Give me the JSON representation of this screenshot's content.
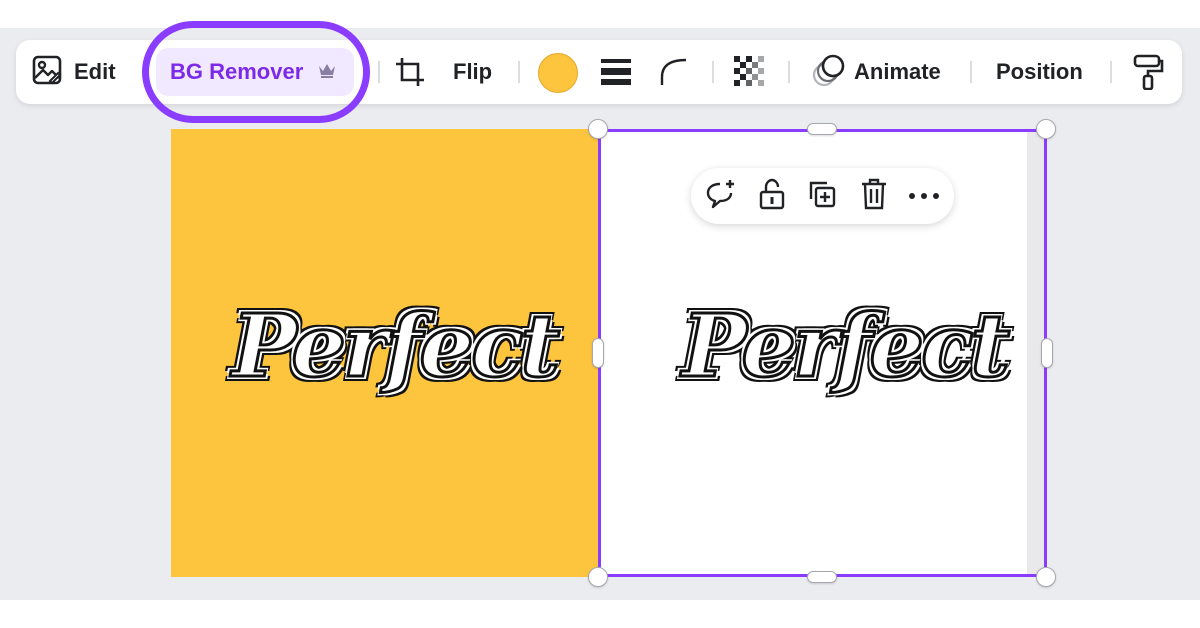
{
  "toolbar": {
    "edit_label": "Edit",
    "bg_remover_label": "BG Remover",
    "flip_label": "Flip",
    "animate_label": "Animate",
    "position_label": "Position",
    "color_swatch": "#fdc43e",
    "highlight_color": "#8b3dff",
    "icons": [
      "edit-image-icon",
      "crown-icon",
      "crop-icon",
      "line-weight-icon",
      "corner-rounding-icon",
      "transparency-icon",
      "animate-icon",
      "paint-roller-icon"
    ]
  },
  "canvas": {
    "left_panel": {
      "color": "#fdc43e",
      "text": "Perfect"
    },
    "right_panel": {
      "color": "#ffffff",
      "text": "Perfect",
      "selected": true
    },
    "selection_color": "#8b3dff"
  },
  "context_menu": {
    "icons": [
      "add-comment-icon",
      "lock-icon",
      "duplicate-icon",
      "delete-icon",
      "more-icon"
    ]
  }
}
